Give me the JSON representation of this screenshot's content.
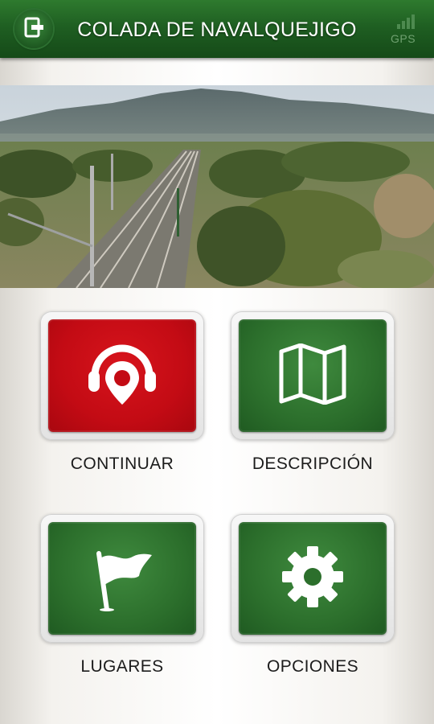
{
  "header": {
    "title": "COLADA DE NAVALQUEJIGO",
    "gps_label": "GPS",
    "exit_icon": "exit-icon",
    "gps_icon": "gps-signal-icon",
    "bar_color": "#1f5f22"
  },
  "hero": {
    "description_icon": "landscape-photo"
  },
  "menu": {
    "continue_label": "CONTINUAR",
    "continue_icon": "audio-guide-pin-icon",
    "description_label": "DESCRIPCIÓN",
    "description_icon": "map-icon",
    "places_label": "LUGARES",
    "places_icon": "flag-icon",
    "options_label": "OPCIONES",
    "options_icon": "gear-icon",
    "accent_red": "#c30b14",
    "accent_green": "#2c6f2c"
  }
}
